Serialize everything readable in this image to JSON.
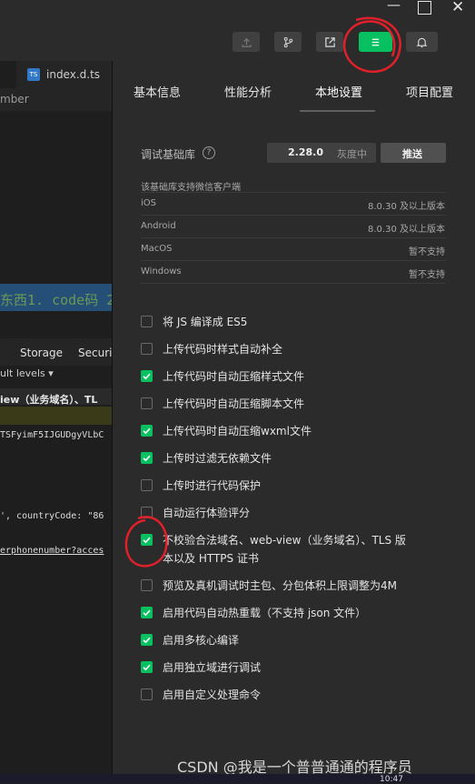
{
  "left_panel": {
    "tab": "index.d.ts",
    "frag_mber": "mber",
    "frag_code": "东西1. code码 2",
    "devtools_tabs": [
      "Storage",
      "Securi"
    ],
    "levels": "ult levels ▾",
    "frag_view": "iew（业务域名）、TL",
    "frag_hash": "TSFyimF5IJGUDgyVLbC",
    "frag_country": "', countryCode: \"86",
    "frag_link": "erphonenumber?acces"
  },
  "tabs": [
    "基本信息",
    "性能分析",
    "本地设置",
    "项目配置"
  ],
  "debug_lib": {
    "label": "调试基础库",
    "version": "2.28.0",
    "gray": "灰度中",
    "push": "推送",
    "note": "该基础库支持微信客户端",
    "rows": [
      {
        "os": "iOS",
        "support": "8.0.30 及以上版本"
      },
      {
        "os": "Android",
        "support": "8.0.30 及以上版本"
      },
      {
        "os": "MacOS",
        "support": "暂不支持"
      },
      {
        "os": "Windows",
        "support": "暂不支持"
      }
    ]
  },
  "options": [
    {
      "label": "将 JS 编译成 ES5",
      "checked": false
    },
    {
      "label": "上传代码时样式自动补全",
      "checked": false
    },
    {
      "label": "上传代码时自动压缩样式文件",
      "checked": true
    },
    {
      "label": "上传代码时自动压缩脚本文件",
      "checked": false
    },
    {
      "label": "上传代码时自动压缩wxml文件",
      "checked": true
    },
    {
      "label": "上传时过滤无依赖文件",
      "checked": true
    },
    {
      "label": "上传时进行代码保护",
      "checked": false
    },
    {
      "label": "自动运行体验评分",
      "checked": false
    },
    {
      "label": "不校验合法域名、web-view（业务域名）、TLS 版",
      "label2": "本以及 HTTPS 证书",
      "checked": true
    },
    {
      "label": "预览及真机调试时主包、分包体积上限调整为4M",
      "checked": false
    },
    {
      "label": "启用代码自动热重载（不支持 json 文件）",
      "checked": true
    },
    {
      "label": "启用多核心编译",
      "checked": true
    },
    {
      "label": "启用独立域进行调试",
      "checked": true
    },
    {
      "label": "启用自定义处理命令",
      "checked": false
    }
  ],
  "watermark": "CSDN @我是一个普普通通的程序员",
  "clock": "10:47",
  "colors": {
    "accent": "#07c160",
    "annotation": "#e0202a"
  },
  "icons": [
    "minimize-icon",
    "maximize-icon",
    "close-icon",
    "upload-icon",
    "branch-icon",
    "external-link-icon",
    "menu-icon",
    "bell-icon",
    "help-icon",
    "ts-file-icon"
  ]
}
